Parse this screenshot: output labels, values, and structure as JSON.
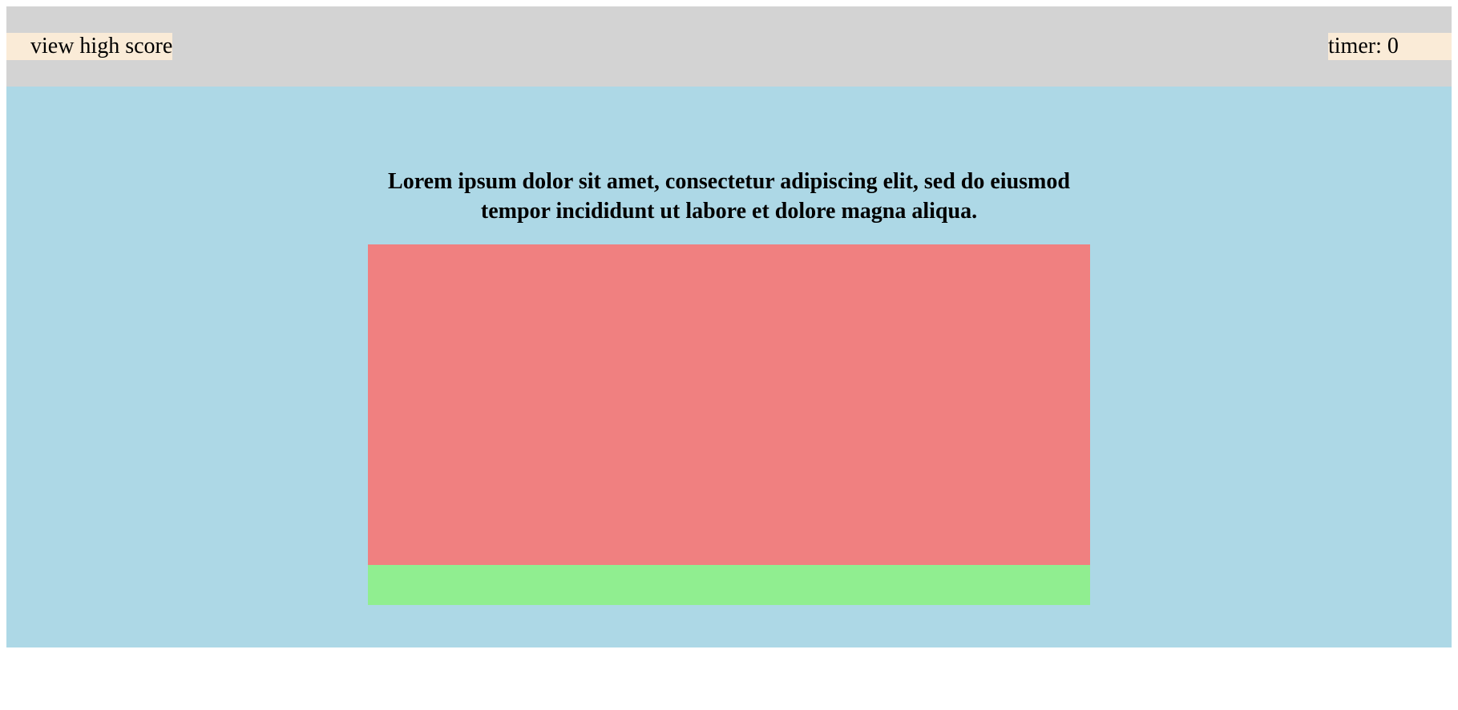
{
  "header": {
    "high_score_link": "view high score",
    "timer_label": "timer: 0"
  },
  "quiz": {
    "question": "Lorem ipsum dolor sit amet, consectetur adipiscing elit, sed do eiusmod tempor incididunt ut labore et dolore magna aliqua."
  },
  "colors": {
    "header_bg": "#d3d3d3",
    "header_item_bg": "#faebd7",
    "main_bg": "#add8e6",
    "answers_bg": "#f08080",
    "result_bg": "#90ee90"
  }
}
